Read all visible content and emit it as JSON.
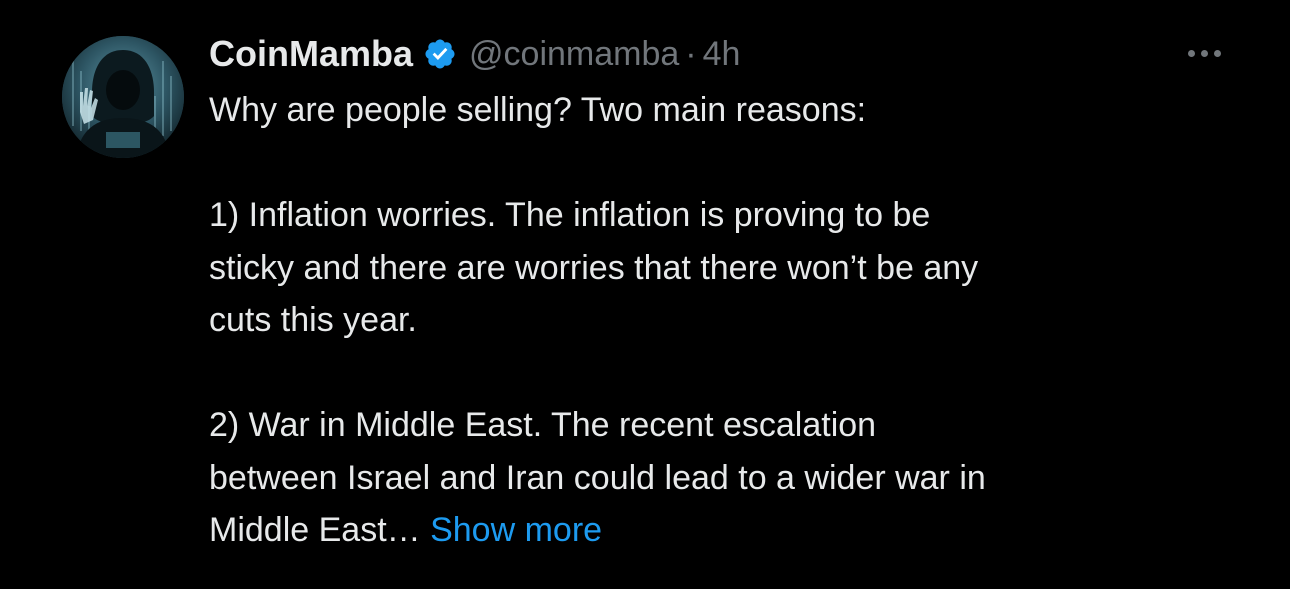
{
  "tweet": {
    "author": {
      "display_name": "CoinMamba",
      "handle": "@coinmamba",
      "verified": true,
      "verified_icon": "verified-badge-icon",
      "avatar_icon": "hooded-figure-avatar"
    },
    "separator": "·",
    "time": "4h",
    "more_icon": "more-options-icon",
    "text": {
      "intro": "Why are people selling? Two main reasons:",
      "point1_line1": "1) Inflation worries. The inflation is proving to be",
      "point1_line2": "sticky and there are worries that there won’t be any",
      "point1_line3": "cuts this year.",
      "point2_line1": "2) War in Middle East. The recent escalation",
      "point2_line2": "between Israel and Iran could lead to a wider war in",
      "point2_line3": "Middle East…",
      "show_more": "Show more"
    }
  },
  "colors": {
    "background": "#000000",
    "primary_text": "#e7e9ea",
    "secondary_text": "#71767b",
    "accent": "#1d9bf0"
  }
}
